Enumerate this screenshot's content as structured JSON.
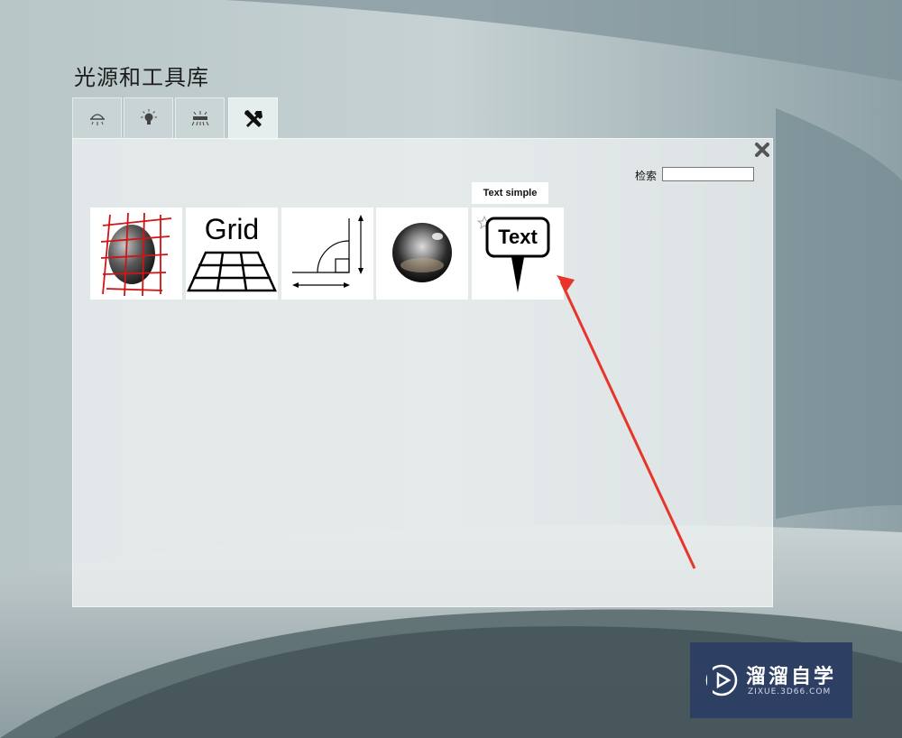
{
  "window": {
    "title": "光源和工具库"
  },
  "tabs": [
    {
      "icon": "ceiling-light-icon",
      "active": false
    },
    {
      "icon": "bulb-light-icon",
      "active": false
    },
    {
      "icon": "area-light-icon",
      "active": false
    },
    {
      "icon": "tools-icon",
      "active": true
    }
  ],
  "search": {
    "label": "检索",
    "value": "",
    "placeholder": ""
  },
  "tooltip": {
    "text": "Text simple"
  },
  "tools": [
    {
      "icon": "projection-grid-icon",
      "label": ""
    },
    {
      "icon": "grid-floor-icon",
      "label": "Grid"
    },
    {
      "icon": "measure-icon",
      "label": ""
    },
    {
      "icon": "chrome-sphere-icon",
      "label": ""
    },
    {
      "icon": "text-marker-icon",
      "label": "Text"
    }
  ],
  "annotation": {
    "color": "#e8352b",
    "shape": "arrow"
  },
  "watermark": {
    "name": "溜溜自学",
    "url": "ZIXUE.3D66.COM"
  },
  "colors": {
    "accent_red": "#d42020",
    "watermark_bg": "#2d3f63"
  }
}
